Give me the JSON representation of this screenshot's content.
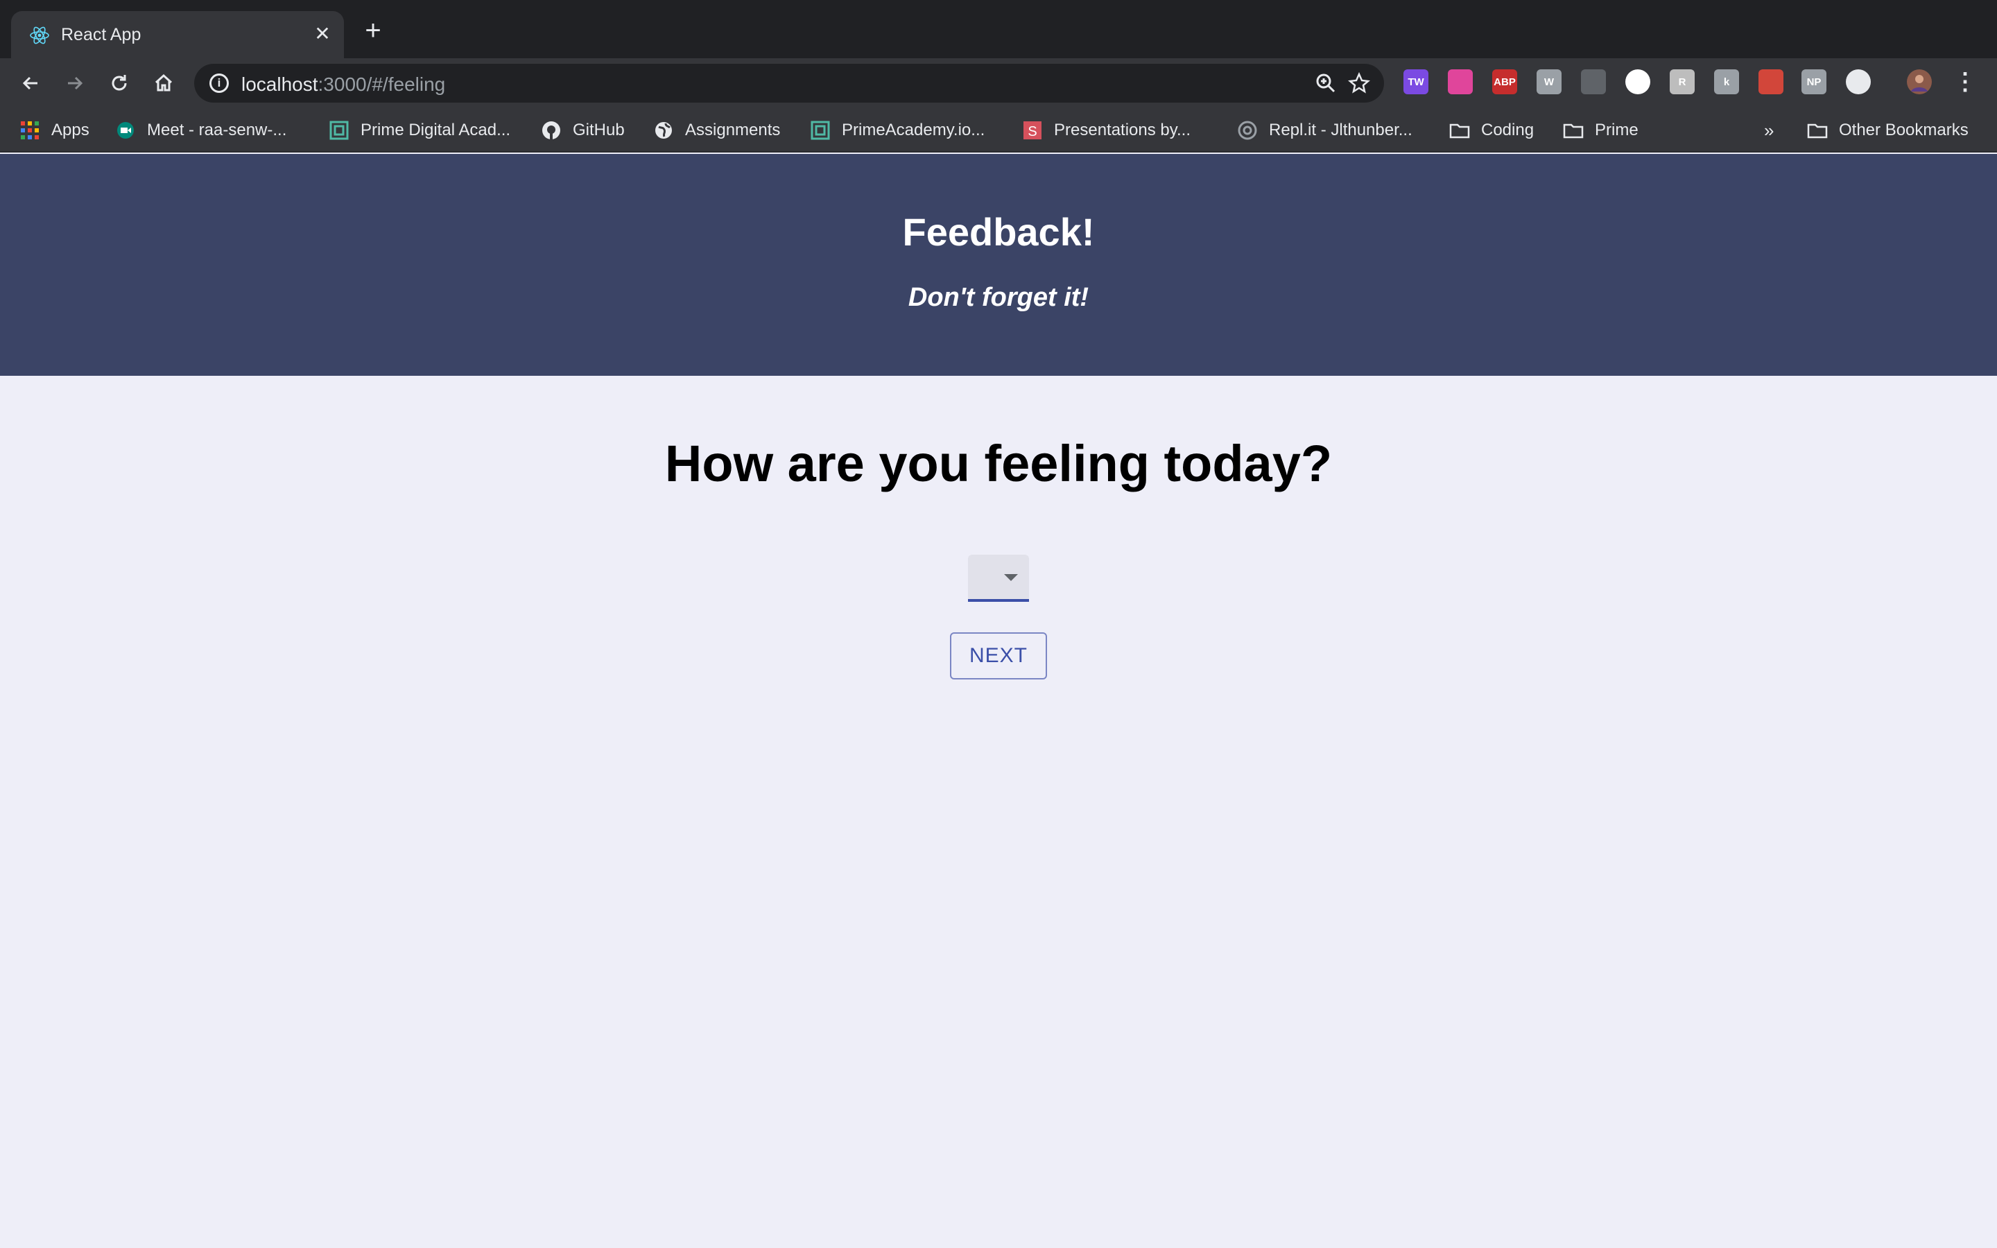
{
  "browser": {
    "tab": {
      "title": "React App"
    },
    "address": {
      "host": "localhost",
      "path": ":3000/#/feeling"
    },
    "bookmarks": [
      {
        "label": "Apps",
        "icon": "apps-grid-icon"
      },
      {
        "label": "Meet - raa-senw-...",
        "icon": "meet-icon"
      },
      {
        "label": "Prime Digital Acad...",
        "icon": "prime-icon"
      },
      {
        "label": "GitHub",
        "icon": "github-icon"
      },
      {
        "label": "Assignments",
        "icon": "globe-icon"
      },
      {
        "label": "PrimeAcademy.io...",
        "icon": "prime-icon"
      },
      {
        "label": "Presentations by...",
        "icon": "slides-icon"
      },
      {
        "label": "Repl.it - Jlthunber...",
        "icon": "replit-icon"
      },
      {
        "label": "Coding",
        "icon": "folder-icon"
      },
      {
        "label": "Prime",
        "icon": "folder-icon"
      }
    ],
    "overflow": "»",
    "other_bookmarks": "Other Bookmarks",
    "extensions": [
      {
        "label": "TW",
        "color": "#7b4ae2"
      },
      {
        "label": "",
        "color": "#e0459b"
      },
      {
        "label": "ABP",
        "color": "#c62d2d"
      },
      {
        "label": "W",
        "color": "#9aa0a6"
      },
      {
        "label": "",
        "color": "#5f6368"
      },
      {
        "label": "",
        "color": "#ffffff"
      },
      {
        "label": "R",
        "color": "#bdbdbd"
      },
      {
        "label": "k",
        "color": "#9aa0a6"
      },
      {
        "label": "",
        "color": "#d2463a"
      },
      {
        "label": "NP",
        "color": "#9aa0a6"
      },
      {
        "label": "",
        "color": "#e8eaed"
      }
    ]
  },
  "app": {
    "title": "Feedback!",
    "subtitle": "Don't forget it!",
    "header_color": "#3b4466",
    "question": "How are you feeling today?",
    "select_value": "",
    "next_label": "NEXT",
    "accent": "#3b4fa8"
  }
}
